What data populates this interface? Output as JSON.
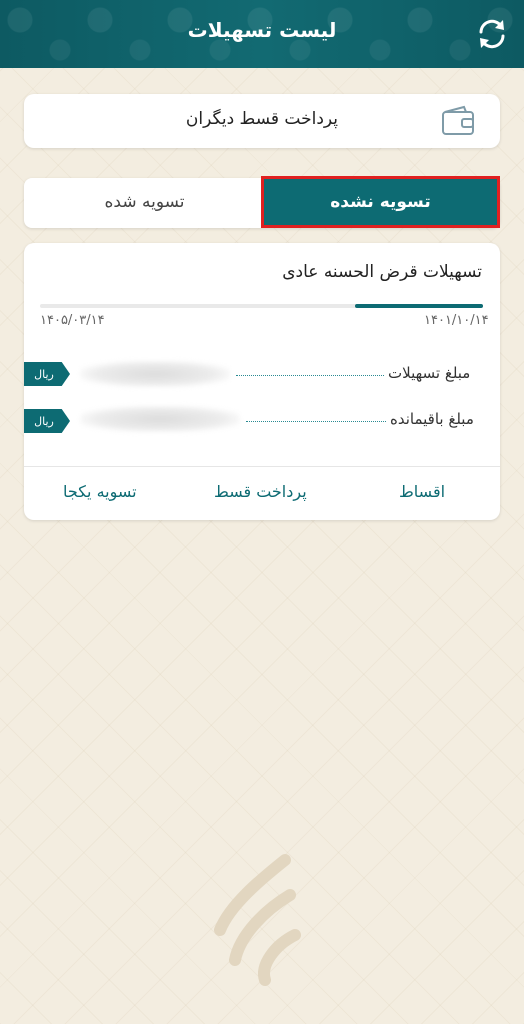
{
  "header": {
    "title": "لیست تسهیلات",
    "refresh_icon": "refresh-icon",
    "background": "#0d5a62"
  },
  "pay_other": {
    "label": "پرداخت قسط دیگران",
    "icon": "wallet-icon"
  },
  "tabs": {
    "active": "تسویه نشده",
    "inactive": "تسویه شده",
    "accent": "#0d6b73",
    "highlight": "#e02020"
  },
  "loan": {
    "title": "تسهیلات قرض الحسنه عادی",
    "start_date": "۱۴۰۱/۱۰/۱۴",
    "end_date": "۱۴۰۵/۰۳/۱۴",
    "progress_fraction": 0.29,
    "rows": [
      {
        "label": "مبلغ تسهیلات",
        "currency": "ریال"
      },
      {
        "label": "مبلغ باقیمانده",
        "currency": "ریال"
      }
    ],
    "actions": {
      "installments": "اقساط",
      "pay_installment": "پرداخت قسط",
      "settle_all": "تسویه یکجا"
    }
  },
  "watermark_icon": "bank-logo-icon"
}
